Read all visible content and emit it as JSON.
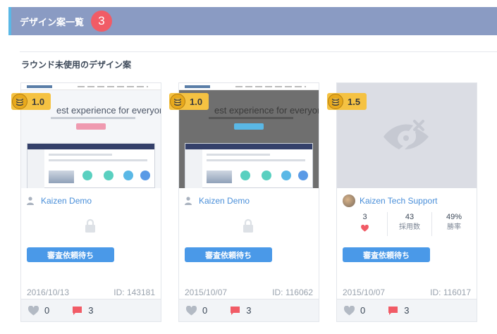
{
  "header": {
    "title": "デザイン案一覧",
    "count": "3"
  },
  "section": {
    "title": "ラウンド未使用のデザイン案"
  },
  "cards": [
    {
      "badge_value": "1.0",
      "thumbnail": {
        "style": "light",
        "headline": "est experience for everyone"
      },
      "author": "Kaizen Demo",
      "status": "審査依頼待ち",
      "date": "2016/10/13",
      "id_label": "ID: 143181",
      "likes": "0",
      "comments": "3"
    },
    {
      "badge_value": "1.0",
      "thumbnail": {
        "style": "dark",
        "headline": "est experience for everyone"
      },
      "author": "Kaizen Demo",
      "status": "審査依頼待ち",
      "date": "2015/10/07",
      "id_label": "ID: 116062",
      "likes": "0",
      "comments": "3"
    },
    {
      "badge_value": "1.5",
      "thumbnail": {
        "style": "hidden",
        "icon": "eye-slash-icon"
      },
      "author": "Kaizen Tech Support",
      "stats": {
        "likes": "3",
        "adopted": "43",
        "adopted_label": "採用数",
        "win_rate": "49%",
        "win_rate_label": "勝率"
      },
      "status": "審査依頼待ち",
      "date": "2015/10/07",
      "id_label": "ID: 116017",
      "likes": "0",
      "comments": "3"
    }
  ],
  "colors": {
    "header_bg": "#8a9bc3",
    "header_accent": "#5ab8e6",
    "count_badge": "#f15b66",
    "price_badge": "#f5c242",
    "link": "#4a8fd9",
    "status_button": "#4a99e8",
    "comment_icon": "#f15b66"
  }
}
